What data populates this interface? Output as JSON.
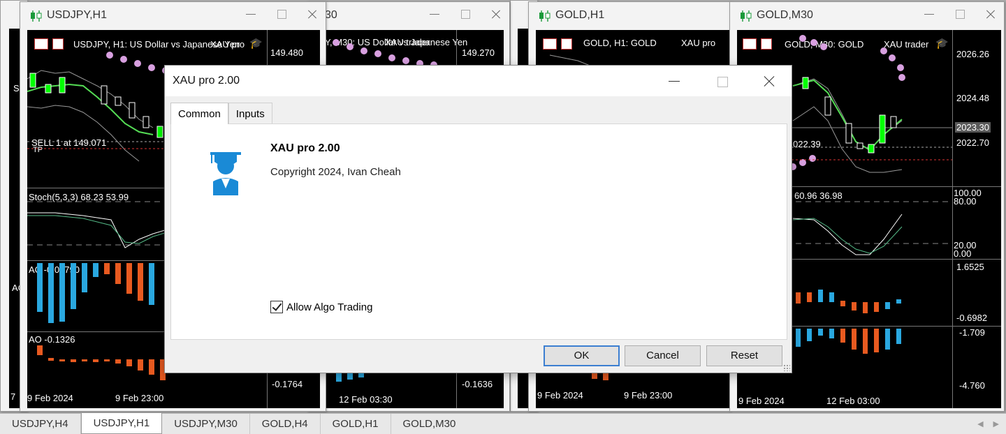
{
  "colors": {
    "chart_bg": "#000000",
    "candle_bull": "#00ff00",
    "candle_bear": "#ffffff",
    "sar_dots": "#d8a0e0",
    "osc_up": "#2aa8e0",
    "osc_down": "#e85a20",
    "ma_green": "#55dd55",
    "accent_button": "#3c7fd1"
  },
  "windows": [
    {
      "title": "USDJPY,H1",
      "chart_label": "USDJPY, H1:  US Dollar vs Japanese Yen",
      "ea_label": "XAU pro",
      "price_top": "149.480",
      "order_label": "SELL 1 at 149.071",
      "tp_label": "TP",
      "stoch_label": "Stoch(5,3,3) 68.23 53.99",
      "ac_label": "AC -0.00790",
      "ao_label": "AO -0.1326",
      "ao_bottom": "-0.1764",
      "x_labels": [
        "9 Feb 2024",
        "9 Feb 23:00"
      ]
    },
    {
      "title_partial": "30",
      "chart_label": "Y, M30:  US Dollar vs Japanese Yen",
      "ea_label": "XAU trader",
      "price_top": "149.270",
      "ao_bottom": "-0.1636",
      "x_labels": [
        "12 Feb 03:30"
      ]
    },
    {
      "title": "GOLD,H1",
      "chart_label": "GOLD, H1:  GOLD",
      "ea_label": "XAU pro",
      "x_labels": [
        "9 Feb 2024",
        "9 Feb 23:00"
      ]
    },
    {
      "title": "GOLD,M30",
      "chart_label": "GOLD, M30:  GOLD",
      "ea_label": "XAU trader",
      "prices": [
        "2026.26",
        "2024.48",
        "2023.30",
        "2022.70"
      ],
      "order_partial": "022.39",
      "stoch_partial": "60.96 36.98",
      "stoch_axis": [
        "100.00",
        "80.00",
        "20.00",
        "0.00"
      ],
      "ac_axis": [
        "1.6525",
        "-0.6982"
      ],
      "ao_axis": [
        "-1.709",
        "-4.760"
      ],
      "x_labels": [
        "9 Feb 2024",
        "12 Feb 03:00"
      ]
    }
  ],
  "side_fragments": {
    "s_label": "S",
    "ac_label": "AC",
    "date_digit": "7"
  },
  "dialog": {
    "title": "XAU pro 2.00",
    "tabs": [
      "Common",
      "Inputs"
    ],
    "ea_name": "XAU pro 2.00",
    "copyright": "Copyright 2024, Ivan Cheah",
    "allow_algo_label": "Allow Algo Trading",
    "allow_algo_checked": true,
    "buttons": {
      "ok": "OK",
      "cancel": "Cancel",
      "reset": "Reset"
    }
  },
  "bottom_tabs": [
    {
      "label": "USDJPY,H4",
      "active": false
    },
    {
      "label": "USDJPY,H1",
      "active": true
    },
    {
      "label": "USDJPY,M30",
      "active": false
    },
    {
      "label": "GOLD,H4",
      "active": false
    },
    {
      "label": "GOLD,H1",
      "active": false
    },
    {
      "label": "GOLD,M30",
      "active": false
    }
  ]
}
